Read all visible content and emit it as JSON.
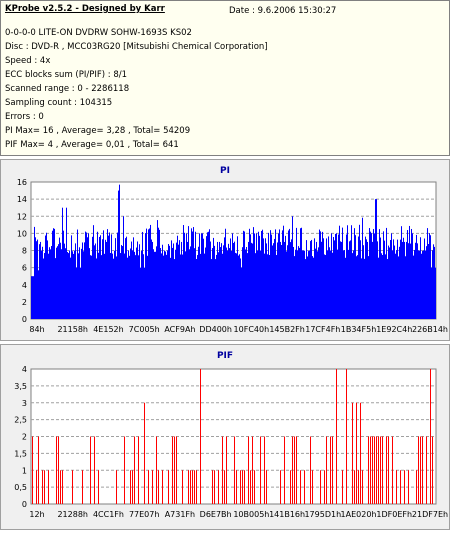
{
  "info": {
    "title": "KProbe v2.5.2 - Designed by Karr",
    "date": "Date : 9.6.2006 15:30:27",
    "lines": [
      "0-0-0-0 LITE-ON DVDRW SOHW-1693S KS02",
      "Disc : DVD-R , MCC03RG20 [Mitsubishi Chemical Corporation]",
      "Speed : 4x",
      "ECC blocks sum (PI/PIF) : 8/1",
      "Scanned range : 0 - 2286118",
      "Sampling count : 104315",
      "Errors : 0",
      "PI Max= 16 , Average= 3,28 , Total= 54209",
      "PIF Max= 4 , Average= 0,01 , Total= 641"
    ]
  },
  "chart_data": [
    {
      "type": "bar",
      "title": "PI",
      "color": "#0000ff",
      "ylim": [
        0,
        16
      ],
      "yticks": [
        "0",
        "2",
        "4",
        "6",
        "8",
        "10",
        "12",
        "14",
        "16"
      ],
      "xticks": [
        "84h",
        "21158h",
        "4E152h",
        "7C005h",
        "ACF9Ah",
        "DD400h",
        "10FC40h",
        "145B2Fh",
        "17CF4Fh",
        "1B34F5h",
        "1E92C4h",
        "226B14h"
      ],
      "grid": true,
      "sampled_values": [
        5,
        9,
        7,
        13,
        8,
        6,
        10,
        7,
        9,
        15,
        12,
        8,
        6,
        9,
        11,
        8,
        7,
        9,
        8,
        10,
        7,
        9,
        8,
        6,
        9,
        10,
        8,
        7,
        9,
        12,
        8,
        7,
        9,
        8,
        10,
        9,
        8,
        11,
        9,
        14,
        10,
        8,
        9,
        10,
        8,
        6
      ]
    },
    {
      "type": "bar",
      "title": "PIF",
      "color": "#ff0000",
      "ylim": [
        0,
        4
      ],
      "yticks": [
        "0",
        "0,5",
        "1",
        "1,5",
        "2",
        "2,5",
        "3",
        "3,5",
        "4"
      ],
      "xticks": [
        "12h",
        "21288h",
        "4CC1Fh",
        "77E07h",
        "A731Fh",
        "D6E7Bh",
        "10B005h",
        "141B16h",
        "1795D1h",
        "1AE020h",
        "1DF0EFh",
        "21DF7Eh"
      ],
      "grid": true,
      "sampled_values": [
        2,
        1,
        2,
        3,
        1,
        2,
        1,
        4,
        2,
        1,
        3,
        2,
        1,
        2,
        1,
        2,
        1,
        4,
        2,
        1,
        1,
        2,
        3,
        1,
        2,
        1,
        2,
        1,
        2,
        1,
        3,
        2,
        1,
        2,
        4,
        1,
        2,
        4
      ]
    }
  ]
}
